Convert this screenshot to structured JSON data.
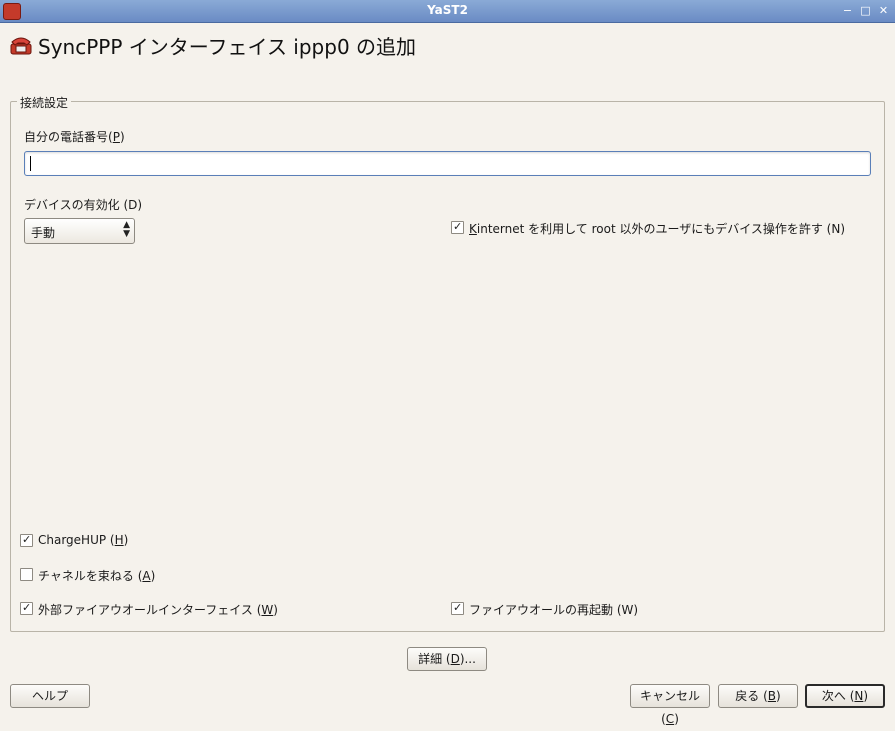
{
  "window": {
    "title": "YaST2",
    "controls": {
      "minimize": "−",
      "maximize": "□",
      "close": "✕"
    }
  },
  "heading": {
    "text": "SyncPPP インターフェイス ippp0 の追加",
    "icon": "phone-icon"
  },
  "connection": {
    "legend": "接続設定",
    "phone_label_pre": "自分の電話番号(",
    "phone_label_key": "P",
    "phone_label_post": ")",
    "phone_value": "",
    "activation_label": "デバイスの有効化 (D)",
    "activation_value": "手動",
    "kinternet_key": "K",
    "kinternet_rest": "internet を利用して root 以外のユーザにもデバイス操作を許す (N)",
    "kinternet_checked": true,
    "chargehup_pre": "ChargeHUP (",
    "chargehup_key": "H",
    "chargehup_post": ")",
    "chargehup_checked": true,
    "bundle_pre": "チャネルを束ねる (",
    "bundle_key": "A",
    "bundle_post": ")",
    "bundle_checked": false,
    "ext_fw_pre": "外部ファイアウオールインターフェイス (",
    "ext_fw_key": "W",
    "ext_fw_post": ")",
    "ext_fw_checked": true,
    "fw_restart_label": "ファイアウオールの再起動 (W)",
    "fw_restart_checked": true
  },
  "buttons": {
    "details_pre": "詳細 (",
    "details_key": "D",
    "details_post": ")...",
    "help": "ヘルプ",
    "cancel_pre": "キャンセル (",
    "cancel_key": "C",
    "cancel_post": ")",
    "back_pre": "戻る (",
    "back_key": "B",
    "back_post": ")",
    "next_pre": "次へ (",
    "next_key": "N",
    "next_post": ")"
  },
  "colors": {
    "titlebar": "#7a9bd0",
    "background": "#f5f2ec",
    "input_border": "#5a7fb8"
  }
}
